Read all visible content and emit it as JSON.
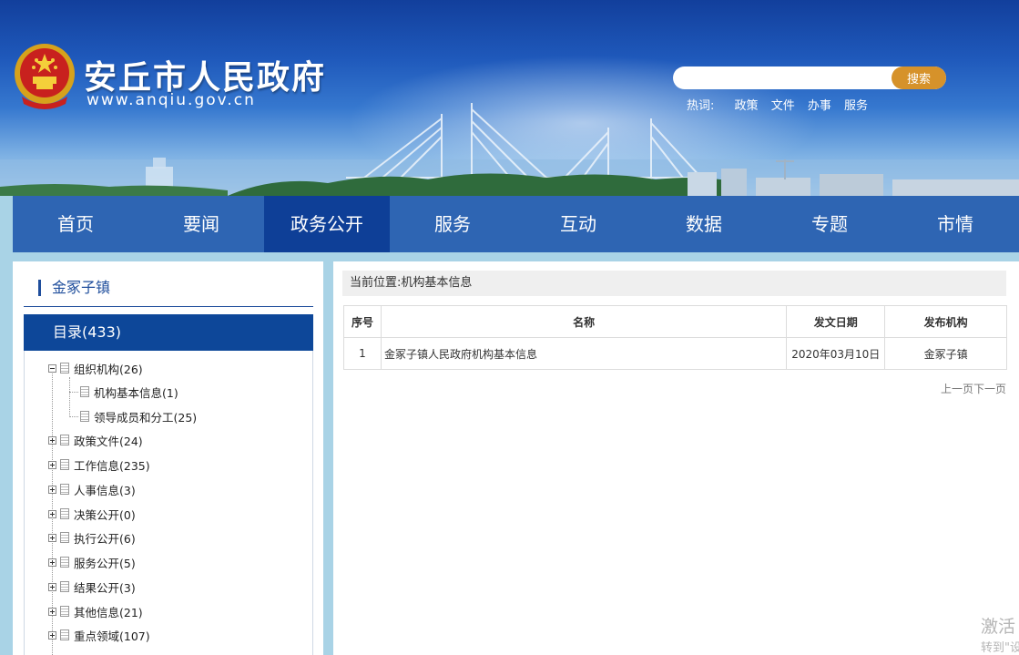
{
  "header": {
    "site_name": "安丘市人民政府",
    "site_url": "www.anqiu.gov.cn",
    "search_placeholder": "",
    "search_button": "搜索",
    "hotwords_label": "热词:",
    "hotwords": [
      "政策",
      "文件",
      "办事",
      "服务"
    ]
  },
  "nav": {
    "items": [
      "首页",
      "要闻",
      "政务公开",
      "服务",
      "互动",
      "数据",
      "专题",
      "市情"
    ],
    "active": "政务公开"
  },
  "sidebar": {
    "title": "金冢子镇",
    "catalog": "目录(433)",
    "tree": [
      {
        "label": "组织机构(26)",
        "expanded": true
      },
      {
        "label": "机构基本信息(1)",
        "child": true
      },
      {
        "label": "领导成员和分工(25)",
        "child": true
      },
      {
        "label": "政策文件(24)"
      },
      {
        "label": "工作信息(235)"
      },
      {
        "label": "人事信息(3)"
      },
      {
        "label": "决策公开(0)"
      },
      {
        "label": "执行公开(6)"
      },
      {
        "label": "服务公开(5)"
      },
      {
        "label": "结果公开(3)"
      },
      {
        "label": "其他信息(21)"
      },
      {
        "label": "重点领域(107)"
      }
    ]
  },
  "main": {
    "breadcrumb": "当前位置:机构基本信息",
    "table": {
      "headers": [
        "序号",
        "名称",
        "发文日期",
        "发布机构"
      ],
      "rows": [
        [
          "1",
          "金冢子镇人民政府机构基本信息",
          "2020年03月10日",
          "金冢子镇"
        ]
      ]
    },
    "pager": {
      "prev": "上一页",
      "next": "下一页"
    }
  },
  "overlay": {
    "watermark_line1": "激活",
    "watermark_line2": "转到\"设"
  }
}
